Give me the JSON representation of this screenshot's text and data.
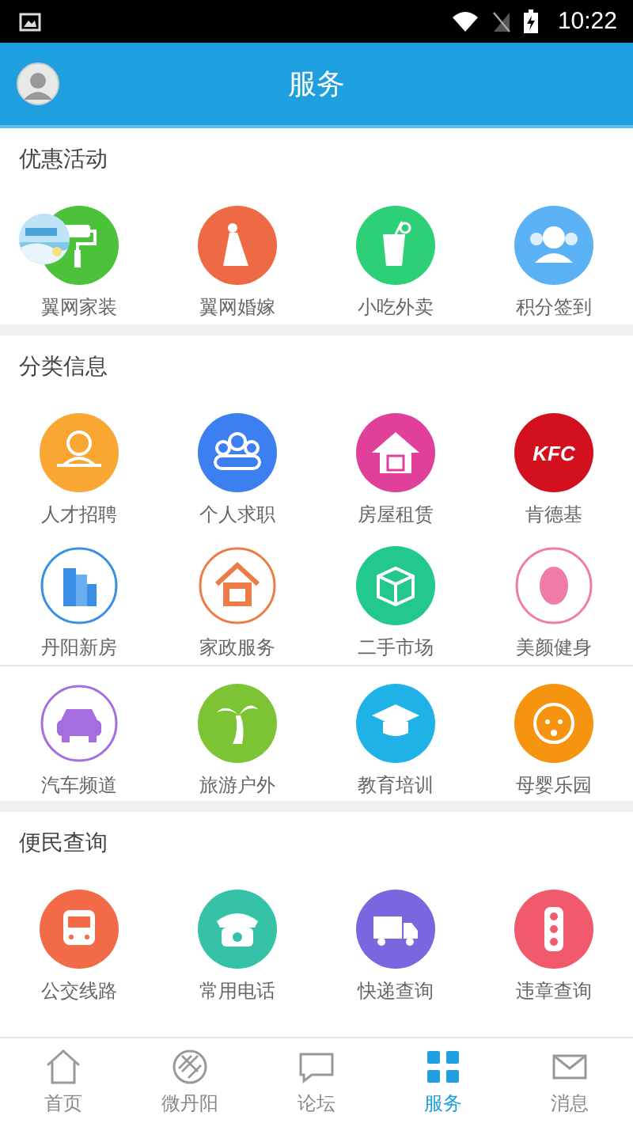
{
  "status_bar": {
    "time": "10:22"
  },
  "header": {
    "title": "服务"
  },
  "sections": [
    {
      "title": "优惠活动",
      "rows": [
        [
          {
            "label": "翼网家装",
            "color": "#4cc23a",
            "outlined": false
          },
          {
            "label": "翼网婚嫁",
            "color": "#ee6a45",
            "outlined": false
          },
          {
            "label": "小吃外卖",
            "color": "#2dcf77",
            "outlined": false
          },
          {
            "label": "积分签到",
            "color": "#5ab2f5",
            "outlined": false
          }
        ]
      ]
    },
    {
      "title": "分类信息",
      "rows": [
        [
          {
            "label": "人才招聘",
            "color": "#f9a632",
            "outlined": false
          },
          {
            "label": "个人求职",
            "color": "#3c7ff0",
            "outlined": false
          },
          {
            "label": "房屋租赁",
            "color": "#e0409a",
            "outlined": false
          },
          {
            "label": "肯德基",
            "color": "#d3111e",
            "outlined": false,
            "badge_text": "KFC"
          }
        ],
        [
          {
            "label": "丹阳新房",
            "color": "#3a8ee6",
            "outlined": true
          },
          {
            "label": "家政服务",
            "color": "#ee7a45",
            "outlined": true
          },
          {
            "label": "二手市场",
            "color": "#22c88c",
            "outlined": false
          },
          {
            "label": "美颜健身",
            "color": "#f07aa8",
            "outlined": true
          }
        ],
        [
          {
            "label": "汽车频道",
            "color": "#a46ee0",
            "outlined": true
          },
          {
            "label": "旅游户外",
            "color": "#7cc434",
            "outlined": false
          },
          {
            "label": "教育培训",
            "color": "#1fb2e6",
            "outlined": false
          },
          {
            "label": "母婴乐园",
            "color": "#f7940f",
            "outlined": false
          }
        ]
      ]
    },
    {
      "title": "便民查询",
      "rows": [
        [
          {
            "label": "公交线路",
            "color": "#f26a47",
            "outlined": false
          },
          {
            "label": "常用电话",
            "color": "#35c2a6",
            "outlined": false
          },
          {
            "label": "快递查询",
            "color": "#7a67e0",
            "outlined": false
          },
          {
            "label": "违章查询",
            "color": "#f05a6c",
            "outlined": false
          }
        ]
      ]
    }
  ],
  "tabs": [
    {
      "label": "首页",
      "selected": false
    },
    {
      "label": "微丹阳",
      "selected": false
    },
    {
      "label": "论坛",
      "selected": false
    },
    {
      "label": "服务",
      "selected": true
    },
    {
      "label": "消息",
      "selected": false
    }
  ]
}
